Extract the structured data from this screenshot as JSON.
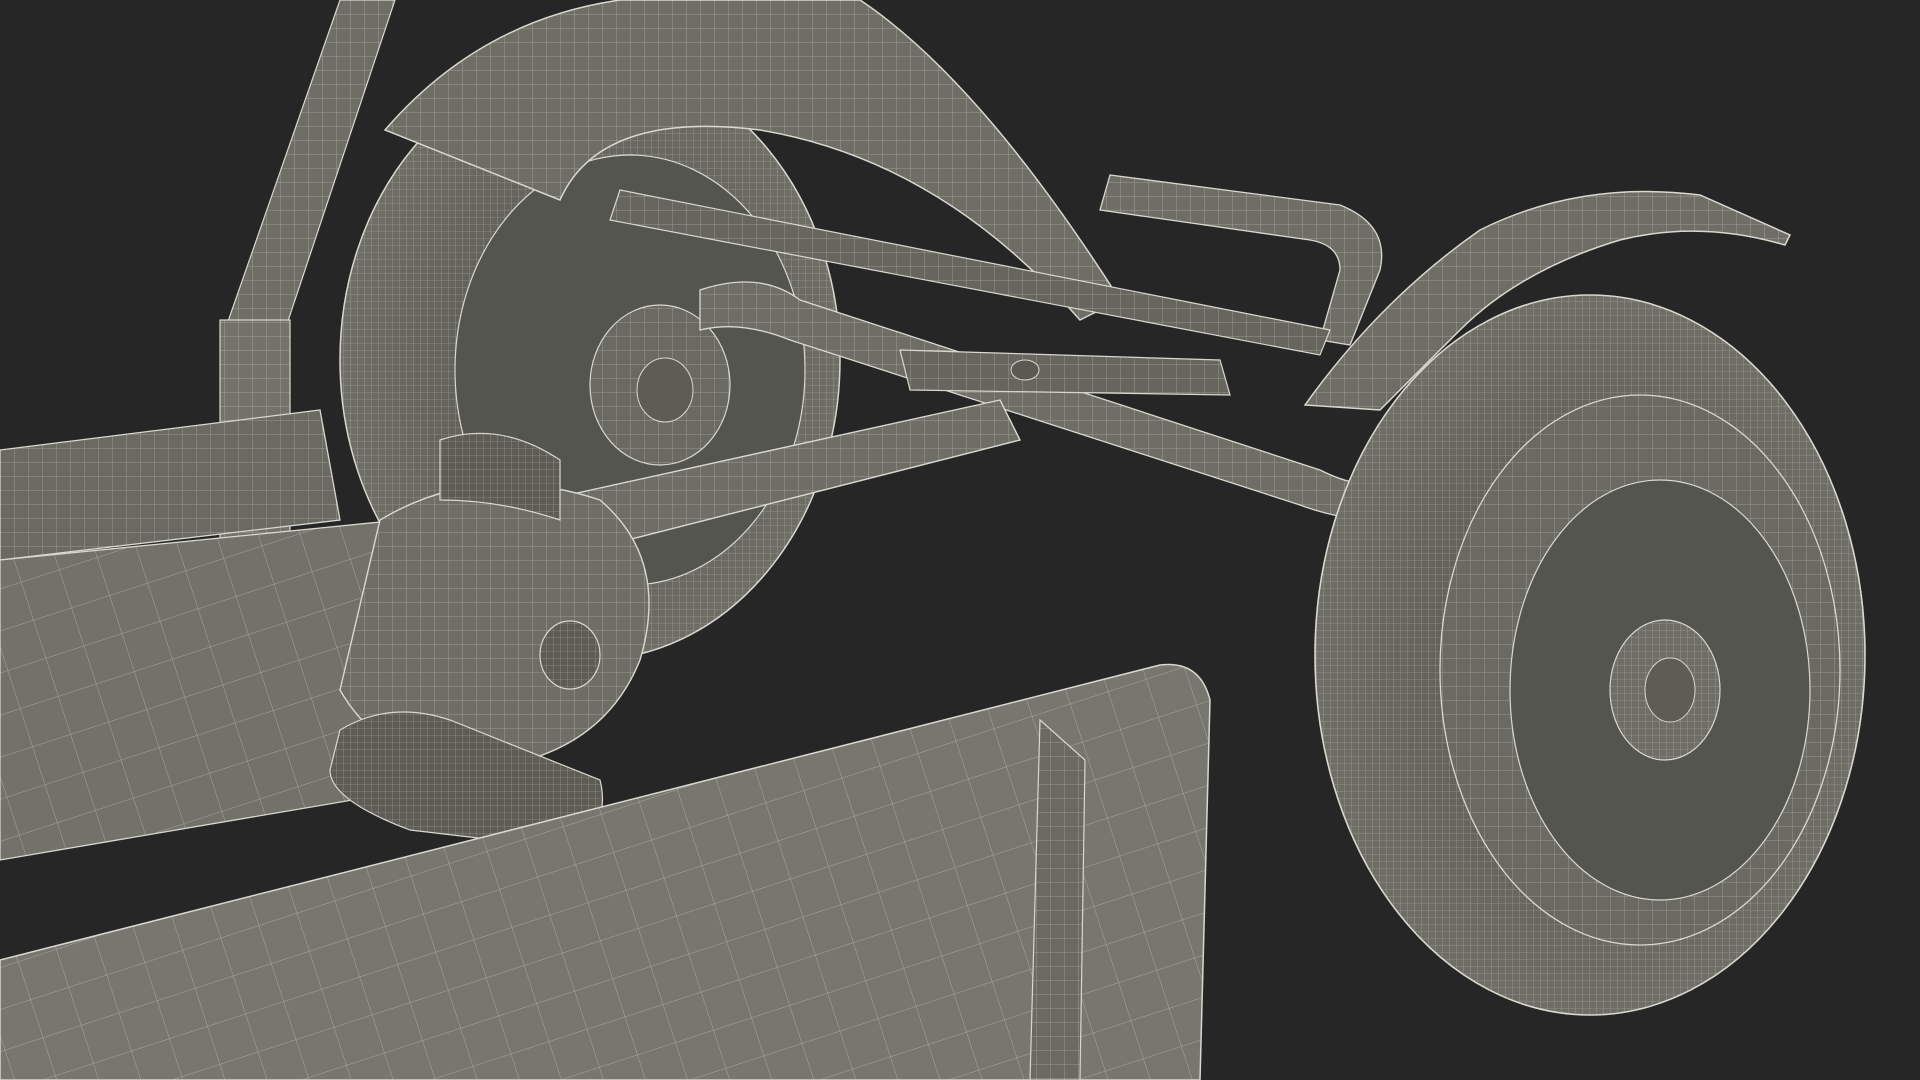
{
  "scene": {
    "subject": "wireframe-3d-render",
    "background_color": "#262626",
    "surface_color": "#6e6e66",
    "surface_shadow_color": "#4a4a44",
    "surface_light_color": "#85857c",
    "wire_color": "#d8d8cf",
    "icons": [
      "wheel-icon",
      "fender-icon",
      "pedal-icon",
      "frame-tube-icon"
    ]
  }
}
